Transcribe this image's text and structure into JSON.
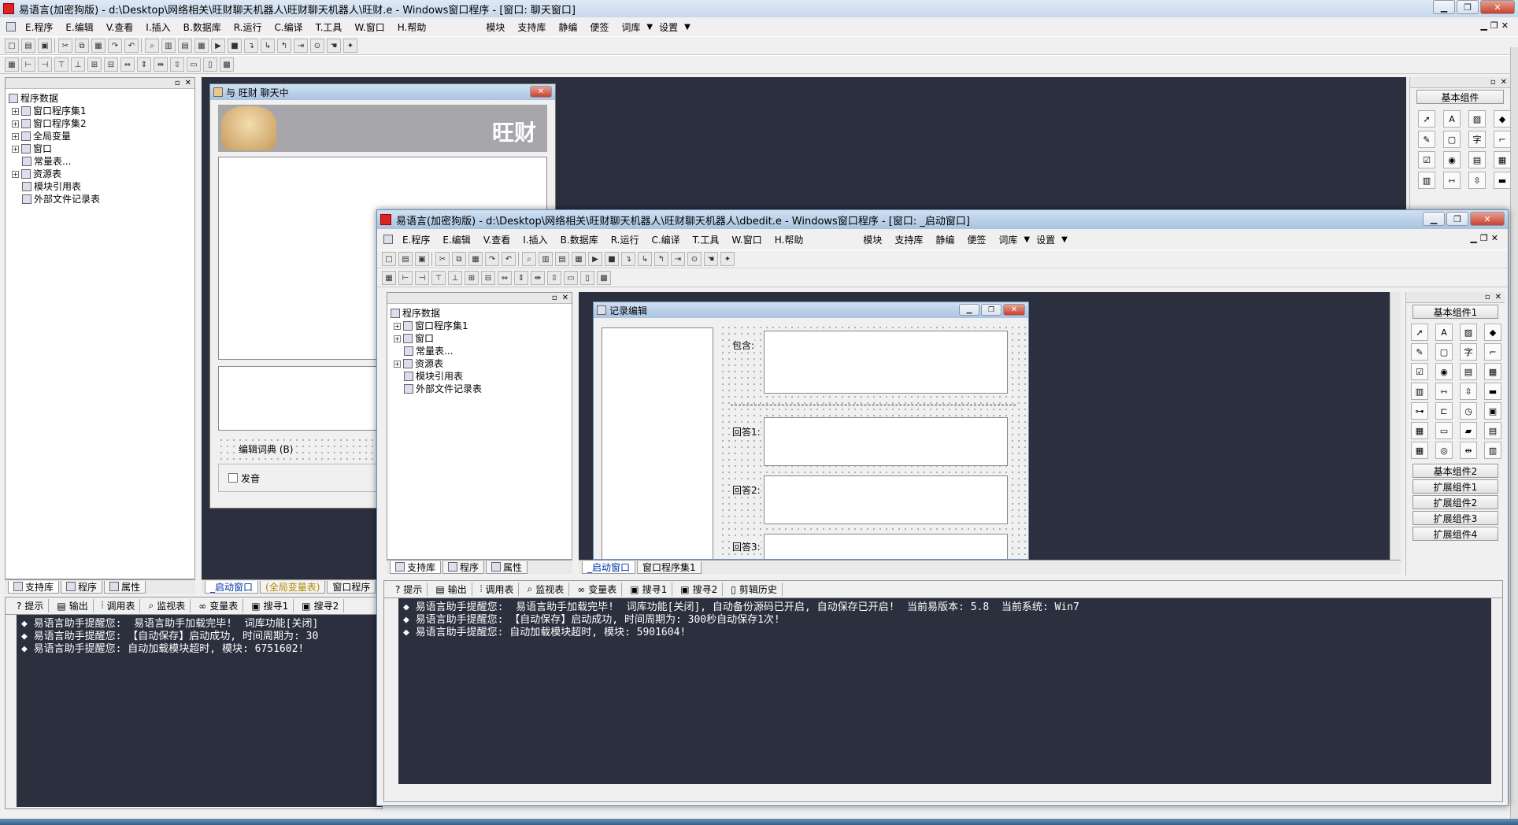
{
  "bg_window": {
    "title": "易语言(加密狗版) - d:\\Desktop\\网络相关\\旺财聊天机器人\\旺财聊天机器人\\旺财.e - Windows窗口程序 - [窗口: 聊天窗口]",
    "menus": [
      "E.程序",
      "E.编辑",
      "V.查看",
      "I.插入",
      "B.数据库",
      "R.运行",
      "C.编译",
      "T.工具",
      "W.窗口",
      "H.帮助"
    ],
    "extra_menus": [
      "模块",
      "支持库",
      "静编",
      "便签",
      "词库",
      "设置"
    ],
    "tree": [
      "程序数据",
      "窗口程序集1",
      "窗口程序集2",
      "全局变量",
      "窗口",
      "常量表...",
      "资源表",
      "模块引用表",
      "外部文件记录表"
    ],
    "left_tabs": [
      "支持库",
      "程序",
      "属性"
    ],
    "doc_tabs": [
      "_启动窗口",
      "(全局变量表)",
      "窗口程序"
    ],
    "output_tabs": [
      "提示",
      "输出",
      "调用表",
      "监视表",
      "变量表",
      "搜寻1",
      "搜寻2"
    ],
    "output_lines": [
      "◆ 易语言助手提醒您:  易语言助手加载完毕!  词库功能[关闭]",
      "",
      "◆ 易语言助手提醒您: 【自动保存】启动成功, 时间周期为: 30",
      "◆ 易语言助手提醒您: 自动加载模块超时, 模块: 6751602!"
    ],
    "chat_form": {
      "title": "与 旺财 聊天中",
      "banner_text": "旺财",
      "edit_dict": "编辑词典 (B)",
      "speak": "发音"
    },
    "palette_title": "基本组件"
  },
  "fg_window": {
    "title": "易语言(加密狗版) - d:\\Desktop\\网络相关\\旺财聊天机器人\\旺财聊天机器人\\dbedit.e - Windows窗口程序 - [窗口: _启动窗口]",
    "menus": [
      "E.程序",
      "E.编辑",
      "V.查看",
      "I.插入",
      "B.数据库",
      "R.运行",
      "C.编译",
      "T.工具",
      "W.窗口",
      "H.帮助"
    ],
    "extra_menus": [
      "模块",
      "支持库",
      "静编",
      "便签",
      "词库",
      "设置"
    ],
    "tree": [
      "程序数据",
      "窗口程序集1",
      "窗口",
      "常量表...",
      "资源表",
      "模块引用表",
      "外部文件记录表"
    ],
    "left_tabs": [
      "支持库",
      "程序",
      "属性"
    ],
    "doc_tabs": [
      "_启动窗口",
      "窗口程序集1"
    ],
    "form": {
      "title": "记录编辑",
      "labels": [
        "包含:",
        "回答1:",
        "回答2:",
        "回答3:"
      ]
    },
    "output_tabs": [
      "提示",
      "输出",
      "调用表",
      "监视表",
      "变量表",
      "搜寻1",
      "搜寻2",
      "剪辑历史"
    ],
    "output_lines": [
      "◆ 易语言助手提醒您:  易语言助手加载完毕!  词库功能[关闭], 自动备份源码已开启, 自动保存已开启!  当前易版本: 5.8  当前系统: Win7",
      "",
      "◆ 易语言助手提醒您: 【自动保存】启动成功, 时间周期为: 300秒自动保存1次!",
      "◆ 易语言助手提醒您: 自动加载模块超时, 模块: 5901604!"
    ],
    "palette_title": "基本组件1",
    "palette_groups": [
      "基本组件2",
      "扩展组件1",
      "扩展组件2",
      "扩展组件3",
      "扩展组件4"
    ]
  },
  "colors": {
    "output_bg": "#2b2f3e",
    "form_caption": "#a9c3e0",
    "close_red": "#c8402c"
  }
}
